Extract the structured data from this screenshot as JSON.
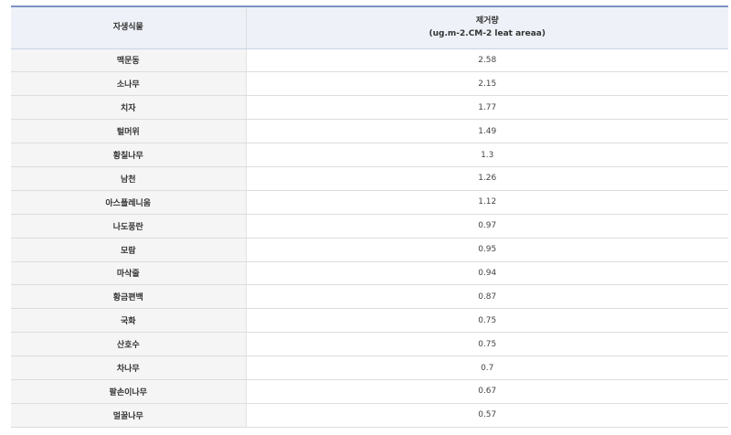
{
  "table": {
    "headers": {
      "plant": "자생식물",
      "removal_line1": "제거량",
      "removal_line2": "(ug.m-2.CM-2 leat areaa)"
    },
    "rows": [
      {
        "plant": "맥문동",
        "value": "2.58"
      },
      {
        "plant": "소나무",
        "value": "2.15"
      },
      {
        "plant": "치자",
        "value": "1.77"
      },
      {
        "plant": "털머위",
        "value": "1.49"
      },
      {
        "plant": "황칠나무",
        "value": "1.3"
      },
      {
        "plant": "남천",
        "value": "1.26"
      },
      {
        "plant": "아스플레니움",
        "value": "1.12"
      },
      {
        "plant": "나도풍란",
        "value": "0.97"
      },
      {
        "plant": "모람",
        "value": "0.95"
      },
      {
        "plant": "마삭줄",
        "value": "0.94"
      },
      {
        "plant": "황금편백",
        "value": "0.87"
      },
      {
        "plant": "국화",
        "value": "0.75"
      },
      {
        "plant": "산호수",
        "value": "0.75"
      },
      {
        "plant": "차나무",
        "value": "0.7"
      },
      {
        "plant": "팔손이나무",
        "value": "0.67"
      },
      {
        "plant": "멀꿀나무",
        "value": "0.57"
      }
    ]
  }
}
